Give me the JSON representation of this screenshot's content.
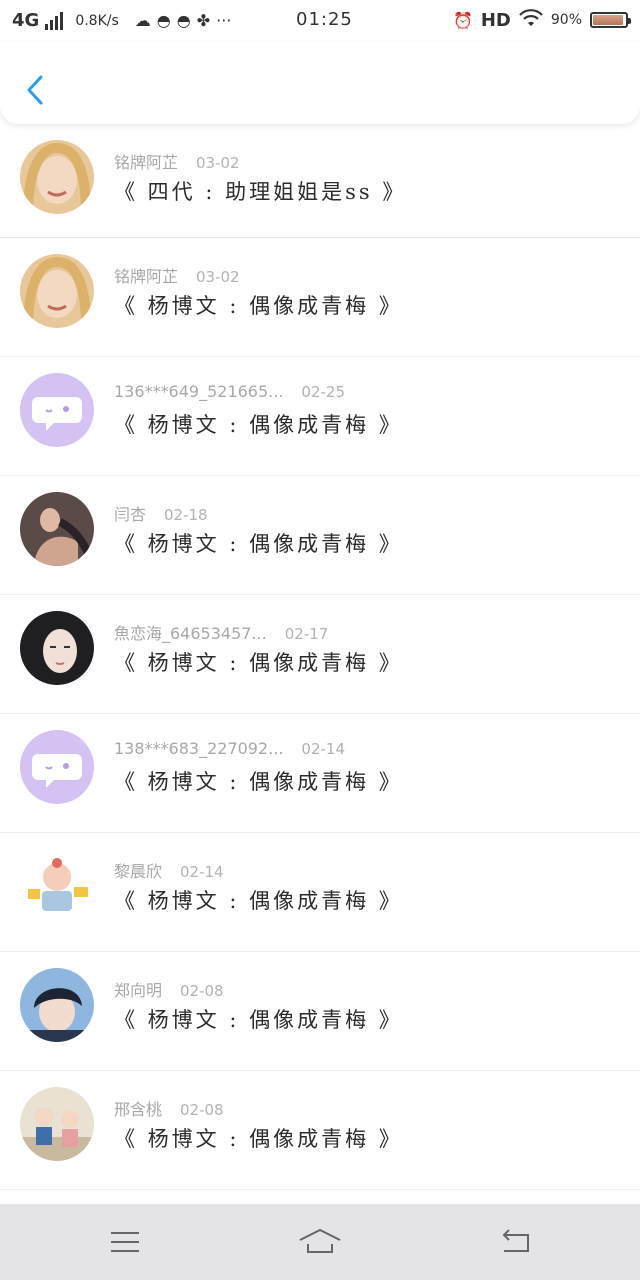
{
  "status_bar": {
    "network": "4G",
    "speed": "0.8K/s",
    "time": "01:25",
    "hd": "HD",
    "battery": "90%",
    "battery_level": 0.9
  },
  "header": {
    "back_icon": "chevron-left-icon"
  },
  "messages": [
    {
      "name": "铭牌阿芷",
      "date": "03-02",
      "title": "《 四代 : 助理姐姐是ss 》",
      "avatar": "blonde-photo"
    },
    {
      "name": "铭牌阿芷",
      "date": "03-02",
      "title": "《 杨博文 : 偶像成青梅 》",
      "avatar": "blonde-photo"
    },
    {
      "name": "136***649_521665...",
      "date": "02-25",
      "title": "《 杨博文 : 偶像成青梅 》",
      "avatar": "default-chat"
    },
    {
      "name": "闫杏",
      "date": "02-18",
      "title": "《 杨博文 : 偶像成青梅 》",
      "avatar": "dark-photo"
    },
    {
      "name": "魚恋海_64653457...",
      "date": "02-17",
      "title": "《 杨博文 : 偶像成青梅 》",
      "avatar": "girl-photo"
    },
    {
      "name": "138***683_227092...",
      "date": "02-14",
      "title": "《 杨博文 : 偶像成青梅 》",
      "avatar": "default-chat"
    },
    {
      "name": "黎晨欣",
      "date": "02-14",
      "title": "《 杨博文 : 偶像成青梅 》",
      "avatar": "cartoon-pig"
    },
    {
      "name": "郑向明",
      "date": "02-08",
      "title": "《 杨博文 : 偶像成青梅 》",
      "avatar": "boy-photo"
    },
    {
      "name": "邢含桃",
      "date": "02-08",
      "title": "《 杨博文 : 偶像成青梅 》",
      "avatar": "cartoon-couple"
    }
  ],
  "bottom_nav": [
    "menu-icon",
    "home-icon",
    "back-icon"
  ],
  "colors": {
    "accent": "#2a9df4",
    "default_avatar_bg": "#d4c2f2"
  }
}
